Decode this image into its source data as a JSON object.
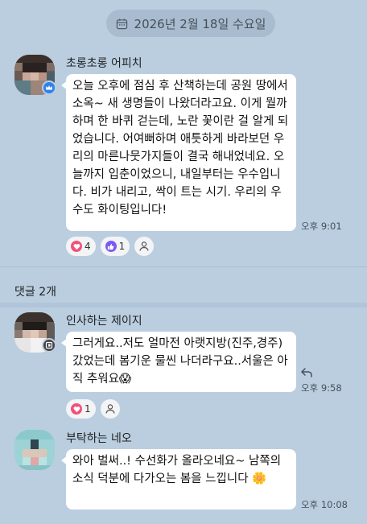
{
  "date_label": "2026년 2월 18일 수요일",
  "post": {
    "author": "초롱초롱 어피치",
    "body": "오늘 오후에 점심 후 산책하는데 공원 땅에서 소옥~ 새 생명들이 나왔더라고요. 이게 뭘까 하며 한 바퀴 걷는데, 노란 꽃이란 걸 알게 되었습니다. 어여뻐하며 애틋하게 바라보던 우리의 마른나뭇가지들이 결국 해내었네요. 오늘까지 입춘이었으니, 내일부터는 우수입니다. 비가 내리고, 싹이 트는 시기. 우리의 우수도 화이팅입니다!",
    "time": "오후 9:01",
    "reactions": [
      {
        "icon": "heart-icon",
        "count": "4"
      },
      {
        "icon": "thumbs-up-icon",
        "count": "1"
      }
    ]
  },
  "comments_label": "댓글 2개",
  "comments": [
    {
      "author": "인사하는 제이지",
      "body": "그러게요..저도 얼마전 아랫지방(진주,경주)갔었는데 봄기운 물씬 나더라구요..서울은 아직 추워요😱",
      "time": "오후 9:58",
      "reactions": [
        {
          "icon": "heart-icon",
          "count": "1"
        }
      ]
    },
    {
      "author": "부탁하는 네오",
      "body": "와아 벌써..! 수선화가 올라오네요~ 남쪽의 소식 덕분에 다가오는 봄을 느낍니다 🌼",
      "time": "오후 10:08"
    }
  ],
  "colors": {
    "background": "#bacee0",
    "heart": "#f2507a",
    "thumbs_up": "#7a5cf0"
  }
}
